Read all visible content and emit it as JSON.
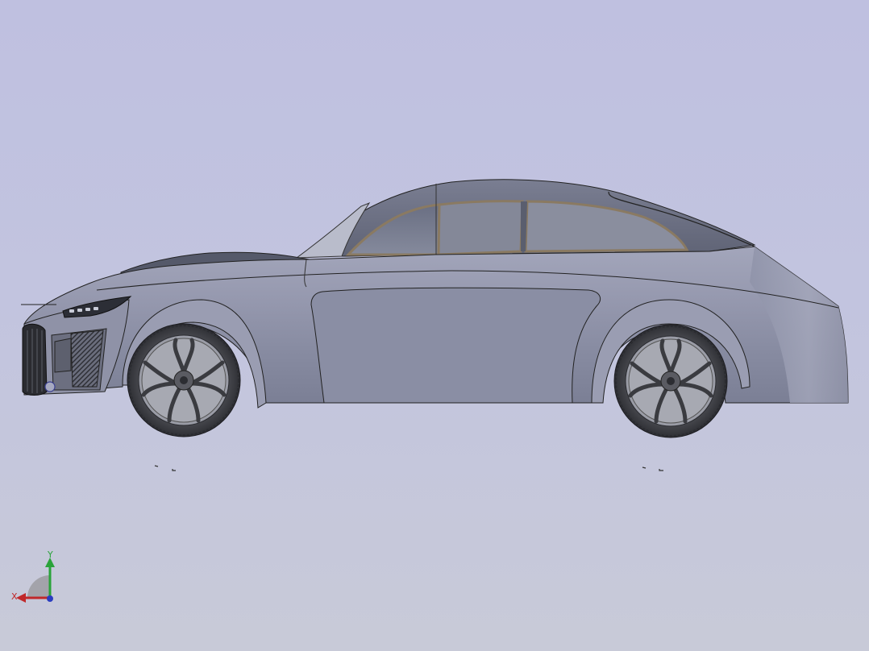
{
  "viewport": {
    "background_top": "#bfc0e0",
    "background_bottom": "#c8cad8"
  },
  "model": {
    "body_color": "#8c90a6",
    "glass_color": "#6d7286",
    "trim_color": "#8a7a62",
    "tire_color": "#3c3d42",
    "rim_color": "#8a8c94"
  },
  "triad": {
    "x_label": "X",
    "y_label": "Y",
    "x_color": "#c0282a",
    "y_color": "#2aa33a",
    "z_color": "#2a3cc0"
  }
}
